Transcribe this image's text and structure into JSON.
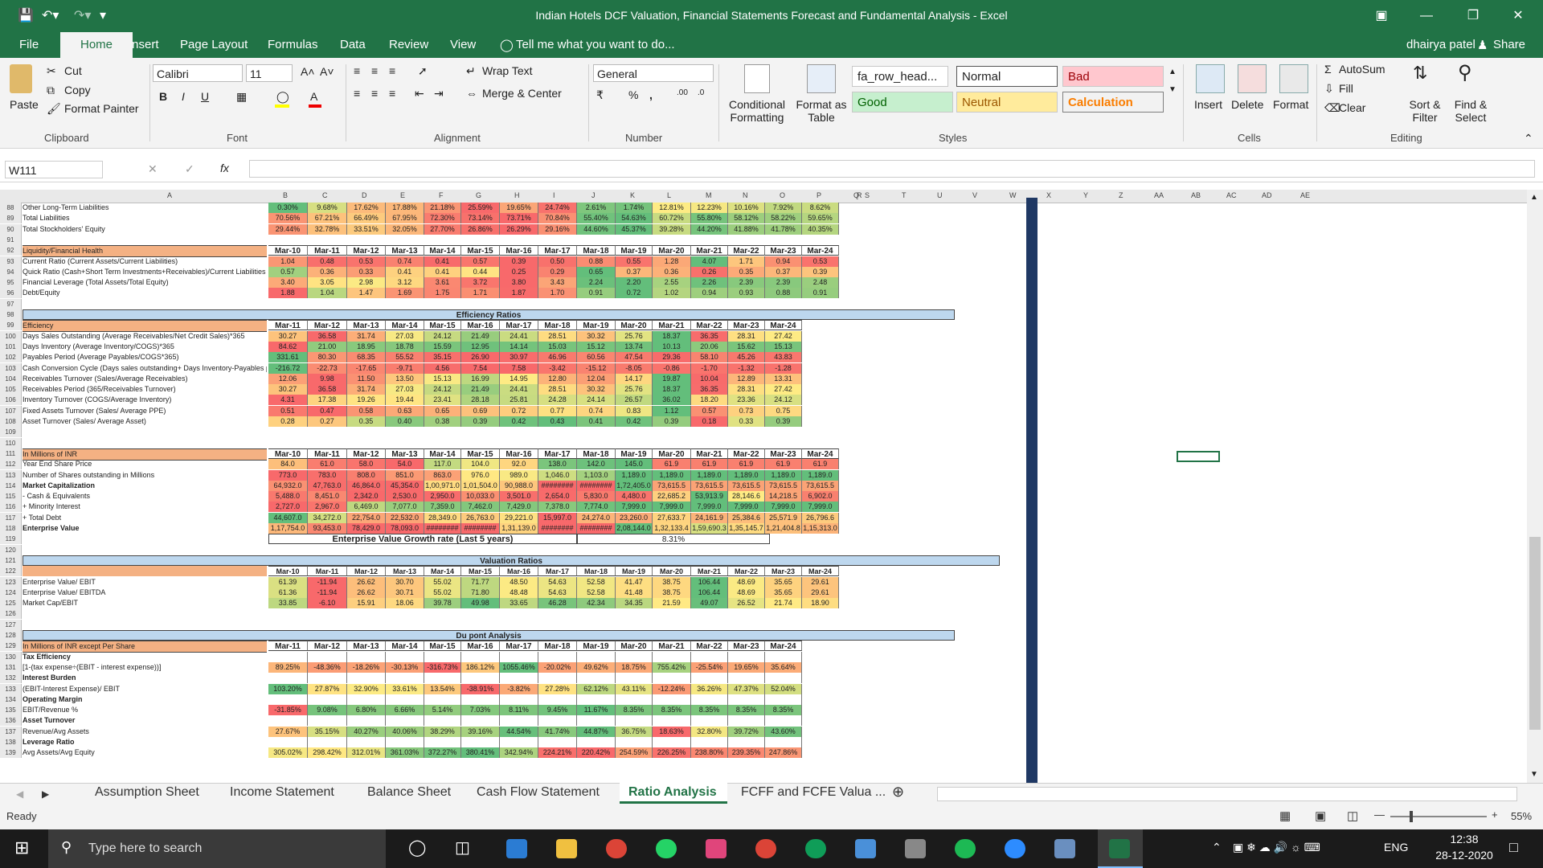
{
  "window": {
    "title": "Indian Hotels DCF Valuation, Financial Statements Forecast and Fundamental Analysis - Excel",
    "user": "dhairya patel",
    "share_label": "Share"
  },
  "ribbon_tabs": [
    "File",
    "Home",
    "Insert",
    "Page Layout",
    "Formulas",
    "Data",
    "Review",
    "View"
  ],
  "tell_me": "Tell me what you want to do...",
  "clipboard": {
    "paste": "Paste",
    "cut": "Cut",
    "copy": "Copy",
    "format_painter": "Format Painter",
    "label": "Clipboard"
  },
  "font": {
    "name": "Calibri",
    "size": "11",
    "label": "Font"
  },
  "alignment": {
    "wrap": "Wrap Text",
    "merge": "Merge & Center",
    "label": "Alignment"
  },
  "number": {
    "format": "General",
    "label": "Number"
  },
  "styles": {
    "conditional": "Conditional Formatting",
    "format_table": "Format as Table",
    "fa_row": "fa_row_head...",
    "normal": "Normal",
    "bad": "Bad",
    "good": "Good",
    "neutral": "Neutral",
    "calculation": "Calculation",
    "label": "Styles"
  },
  "cells": {
    "insert": "Insert",
    "delete": "Delete",
    "format": "Format",
    "label": "Cells"
  },
  "editing": {
    "autosum": "AutoSum",
    "fill": "Fill",
    "clear": "Clear",
    "sort": "Sort & Filter",
    "find": "Find & Select",
    "label": "Editing"
  },
  "formula_bar": {
    "name_box": "W111",
    "fx": "fx",
    "value": ""
  },
  "columns": [
    "A",
    "B",
    "C",
    "D",
    "E",
    "F",
    "G",
    "H",
    "I",
    "J",
    "K",
    "L",
    "M",
    "N",
    "O",
    "P",
    "Q",
    "R",
    "S",
    "T",
    "U",
    "V",
    "W",
    "X",
    "Y",
    "Z",
    "AA",
    "AB",
    "AC",
    "AD",
    "AE"
  ],
  "sections": {
    "top": {
      "rows": [
        {
          "n": "88",
          "label": "Other Long-Term Liabilities",
          "vals": [
            "0.30%",
            "9.68%",
            "17.62%",
            "17.88%",
            "21.18%",
            "25.59%",
            "19.65%",
            "24.74%",
            "2.61%",
            "1.74%",
            "12.81%",
            "12.23%",
            "10.16%",
            "7.92%",
            "8.62%"
          ]
        },
        {
          "n": "89",
          "label": "Total Liabilities",
          "vals": [
            "70.56%",
            "67.21%",
            "66.49%",
            "67.95%",
            "72.30%",
            "73.14%",
            "73.71%",
            "70.84%",
            "55.40%",
            "54.63%",
            "60.72%",
            "55.80%",
            "58.12%",
            "58.22%",
            "59.65%"
          ]
        },
        {
          "n": "90",
          "label": "Total Stockholders' Equity",
          "vals": [
            "29.44%",
            "32.78%",
            "33.51%",
            "32.05%",
            "27.70%",
            "26.86%",
            "26.29%",
            "29.16%",
            "44.60%",
            "45.37%",
            "39.28%",
            "44.20%",
            "41.88%",
            "41.78%",
            "40.35%"
          ]
        }
      ]
    },
    "liquidity": {
      "header_label": "Liquidity/Financial Health",
      "years": [
        "Mar-10",
        "Mar-11",
        "Mar-12",
        "Mar-13",
        "Mar-14",
        "Mar-15",
        "Mar-16",
        "Mar-17",
        "Mar-18",
        "Mar-19",
        "Mar-20",
        "Mar-21",
        "Mar-22",
        "Mar-23",
        "Mar-24"
      ],
      "rows": [
        {
          "n": "93",
          "label": "Current Ratio (Current Assets/Current Liabilities)",
          "vals": [
            "1.04",
            "0.48",
            "0.53",
            "0.74",
            "0.41",
            "0.57",
            "0.39",
            "0.50",
            "0.88",
            "0.55",
            "1.28",
            "4.07",
            "1.71",
            "0.94",
            "0.53"
          ]
        },
        {
          "n": "94",
          "label": "Quick Ratio (Cash+Short Term Investments+Receivables)/Current Liabilities",
          "vals": [
            "0.57",
            "0.36",
            "0.33",
            "0.41",
            "0.41",
            "0.44",
            "0.25",
            "0.29",
            "0.65",
            "0.37",
            "0.36",
            "0.26",
            "0.35",
            "0.37",
            "0.39"
          ]
        },
        {
          "n": "95",
          "label": "Financial Leverage (Total Assets/Total Equity)",
          "vals": [
            "3.40",
            "3.05",
            "2.98",
            "3.12",
            "3.61",
            "3.72",
            "3.80",
            "3.43",
            "2.24",
            "2.20",
            "2.55",
            "2.26",
            "2.39",
            "2.39",
            "2.48"
          ]
        },
        {
          "n": "96",
          "label": "Debt/Equity",
          "vals": [
            "1.88",
            "1.04",
            "1.47",
            "1.69",
            "1.75",
            "1.71",
            "1.87",
            "1.70",
            "0.91",
            "0.72",
            "1.02",
            "0.94",
            "0.93",
            "0.88",
            "0.91"
          ]
        }
      ]
    },
    "efficiency": {
      "title": "Efficiency Ratios",
      "header_label": "Efficiency",
      "years": [
        "Mar-11",
        "Mar-12",
        "Mar-13",
        "Mar-14",
        "Mar-15",
        "Mar-16",
        "Mar-17",
        "Mar-18",
        "Mar-19",
        "Mar-20",
        "Mar-21",
        "Mar-22",
        "Mar-23",
        "Mar-24"
      ],
      "rows": [
        {
          "n": "100",
          "label": "Days Sales Outstanding (Average Receivables/Net Credit Sales)*365",
          "vals": [
            "30.27",
            "36.58",
            "31.74",
            "27.03",
            "24.12",
            "21.49",
            "24.41",
            "28.51",
            "30.32",
            "25.76",
            "18.37",
            "36.35",
            "28.31",
            "27.42"
          ]
        },
        {
          "n": "101",
          "label": "Days Inventory (Average Inventory/COGS)*365",
          "vals": [
            "84.62",
            "21.00",
            "18.95",
            "18.78",
            "15.59",
            "12.95",
            "14.14",
            "15.03",
            "15.12",
            "13.74",
            "10.13",
            "20.06",
            "15.62",
            "15.13"
          ]
        },
        {
          "n": "102",
          "label": "Payables Period (Average Payables/COGS*365)",
          "vals": [
            "331.61",
            "80.30",
            "68.35",
            "55.52",
            "35.15",
            "26.90",
            "30.97",
            "46.96",
            "60.56",
            "47.54",
            "29.36",
            "58.10",
            "45.26",
            "43.83"
          ]
        },
        {
          "n": "103",
          "label": "Cash Conversion Cycle (Days sales outstanding+ Days Inventory-Payables period)",
          "vals": [
            "-216.72",
            "-22.73",
            "-17.65",
            "-9.71",
            "4.56",
            "7.54",
            "7.58",
            "-3.42",
            "-15.12",
            "-8.05",
            "-0.86",
            "-1.70",
            "-1.32",
            "-1.28"
          ]
        },
        {
          "n": "104",
          "label": "Receivables Turnover (Sales/Average Receivables)",
          "vals": [
            "12.06",
            "9.98",
            "11.50",
            "13.50",
            "15.13",
            "16.99",
            "14.95",
            "12.80",
            "12.04",
            "14.17",
            "19.87",
            "10.04",
            "12.89",
            "13.31"
          ]
        },
        {
          "n": "105",
          "label": "Receivables Period (365/Receivables Turnover)",
          "vals": [
            "30.27",
            "36.58",
            "31.74",
            "27.03",
            "24.12",
            "21.49",
            "24.41",
            "28.51",
            "30.32",
            "25.76",
            "18.37",
            "36.35",
            "28.31",
            "27.42"
          ]
        },
        {
          "n": "106",
          "label": "Inventory Turnover (COGS/Average Inventory)",
          "vals": [
            "4.31",
            "17.38",
            "19.26",
            "19.44",
            "23.41",
            "28.18",
            "25.81",
            "24.28",
            "24.14",
            "26.57",
            "36.02",
            "18.20",
            "23.36",
            "24.12"
          ]
        },
        {
          "n": "107",
          "label": "Fixed Assets Turnover (Sales/ Average PPE)",
          "vals": [
            "0.51",
            "0.47",
            "0.58",
            "0.63",
            "0.65",
            "0.69",
            "0.72",
            "0.77",
            "0.74",
            "0.83",
            "1.12",
            "0.57",
            "0.73",
            "0.75"
          ]
        },
        {
          "n": "108",
          "label": "Asset Turnover (Sales/ Average Asset)",
          "vals": [
            "0.28",
            "0.27",
            "0.35",
            "0.40",
            "0.38",
            "0.39",
            "0.42",
            "0.43",
            "0.41",
            "0.42",
            "0.39",
            "0.18",
            "0.33",
            "0.39"
          ]
        }
      ]
    },
    "ev": {
      "header_label": "In Millions of INR",
      "years": [
        "Mar-10",
        "Mar-11",
        "Mar-12",
        "Mar-13",
        "Mar-14",
        "Mar-15",
        "Mar-16",
        "Mar-17",
        "Mar-18",
        "Mar-19",
        "Mar-20",
        "Mar-21",
        "Mar-22",
        "Mar-23",
        "Mar-24"
      ],
      "rows": [
        {
          "n": "112",
          "label": "Year End Share Price",
          "bold": false,
          "vals": [
            "84.0",
            "61.0",
            "58.0",
            "54.0",
            "117.0",
            "104.0",
            "92.0",
            "138.0",
            "142.0",
            "145.0",
            "61.9",
            "61.9",
            "61.9",
            "61.9",
            "61.9"
          ]
        },
        {
          "n": "113",
          "label": "Number of Shares outstanding in Millions",
          "bold": false,
          "vals": [
            "773.0",
            "783.0",
            "808.0",
            "851.0",
            "863.0",
            "976.0",
            "989.0",
            "1,046.0",
            "1,103.0",
            "1,189.0",
            "1,189.0",
            "1,189.0",
            "1,189.0",
            "1,189.0",
            "1,189.0"
          ]
        },
        {
          "n": "114",
          "label": "Market Capitalization",
          "bold": true,
          "vals": [
            "64,932.0",
            "47,763.0",
            "46,864.0",
            "45,354.0",
            "1,00,971.0",
            "1,01,504.0",
            "90,988.0",
            "########",
            "########",
            "1,72,405.0",
            "73,615.5",
            "73,615.5",
            "73,615.5",
            "73,615.5",
            "73,615.5"
          ]
        },
        {
          "n": "115",
          "label": "- Cash & Equivalents",
          "bold": false,
          "vals": [
            "5,488.0",
            "8,451.0",
            "2,342.0",
            "2,530.0",
            "2,950.0",
            "10,033.0",
            "3,501.0",
            "2,654.0",
            "5,830.0",
            "4,480.0",
            "22,685.2",
            "53,913.9",
            "28,146.6",
            "14,218.5",
            "6,902.0"
          ]
        },
        {
          "n": "116",
          "label": "+ Minority Interest",
          "bold": false,
          "vals": [
            "2,727.0",
            "2,967.0",
            "6,469.0",
            "7,077.0",
            "7,359.0",
            "7,462.0",
            "7,429.0",
            "7,378.0",
            "7,774.0",
            "7,999.0",
            "7,999.0",
            "7,999.0",
            "7,999.0",
            "7,999.0",
            "7,999.0"
          ]
        },
        {
          "n": "117",
          "label": "+ Total Debt",
          "bold": false,
          "vals": [
            "44,607.0",
            "34,272.0",
            "22,754.0",
            "22,532.0",
            "28,349.0",
            "26,763.0",
            "29,221.0",
            "15,997.0",
            "24,274.0",
            "23,260.0",
            "27,633.7",
            "24,161.9",
            "25,384.6",
            "25,571.9",
            "26,796.6"
          ]
        },
        {
          "n": "118",
          "label": "Enterprise Value",
          "bold": true,
          "vals": [
            "1,17,754.0",
            "93,453.0",
            "78,429.0",
            "78,093.0",
            "########",
            "########",
            "1,31,139.0",
            "########",
            "########",
            "2,08,144.0",
            "1,32,133.4",
            "1,59,690.3",
            "1,35,145.7",
            "1,21,404.8",
            "1,15,313.0"
          ]
        }
      ],
      "growth_label": "Enterprise Value Growth rate (Last 5 years)",
      "growth_value": "8.31%"
    },
    "valuation": {
      "title": "Valuation Ratios",
      "years": [
        "Mar-10",
        "Mar-11",
        "Mar-12",
        "Mar-13",
        "Mar-14",
        "Mar-15",
        "Mar-16",
        "Mar-17",
        "Mar-18",
        "Mar-19",
        "Mar-20",
        "Mar-21",
        "Mar-22",
        "Mar-23",
        "Mar-24"
      ],
      "rows": [
        {
          "n": "123",
          "label": "Enterprise Value/ EBIT",
          "vals": [
            "61.39",
            "-11.94",
            "26.62",
            "30.70",
            "55.02",
            "71.77",
            "48.50",
            "54.63",
            "52.58",
            "41.47",
            "38.75",
            "106.44",
            "48.69",
            "35.65",
            "29.61"
          ]
        },
        {
          "n": "124",
          "label": "Enterprise Value/ EBITDA",
          "vals": [
            "61.36",
            "-11.94",
            "26.62",
            "30.71",
            "55.02",
            "71.80",
            "48.48",
            "54.63",
            "52.58",
            "41.48",
            "38.75",
            "106.44",
            "48.69",
            "35.65",
            "29.61"
          ]
        },
        {
          "n": "125",
          "label": "Market Cap/EBIT",
          "vals": [
            "33.85",
            "-6.10",
            "15.91",
            "18.06",
            "39.78",
            "49.98",
            "33.65",
            "46.28",
            "42.34",
            "34.35",
            "21.59",
            "49.07",
            "26.52",
            "21.74",
            "18.90"
          ]
        }
      ]
    },
    "dupont": {
      "title": "Du pont Analysis",
      "header_label": "In Millions of INR except Per Share",
      "years": [
        "Mar-11",
        "Mar-12",
        "Mar-13",
        "Mar-14",
        "Mar-15",
        "Mar-16",
        "Mar-17",
        "Mar-18",
        "Mar-19",
        "Mar-20",
        "Mar-21",
        "Mar-22",
        "Mar-23",
        "Mar-24"
      ],
      "rows": [
        {
          "n": "130",
          "label": "Tax Efficiency",
          "bold": true,
          "vals": []
        },
        {
          "n": "131",
          "label": "[1-(tax expense÷(EBIT - interest expense))]",
          "bold": false,
          "vals": [
            "89.25%",
            "-48.36%",
            "-18.26%",
            "-30.13%",
            "-316.73%",
            "186.12%",
            "1055.46%",
            "-20.02%",
            "49.62%",
            "18.75%",
            "755.42%",
            "-25.54%",
            "19.65%",
            "35.64%"
          ]
        },
        {
          "n": "132",
          "label": "Interest Burden",
          "bold": true,
          "vals": []
        },
        {
          "n": "133",
          "label": "(EBIT-Interest Expense)/ EBIT",
          "bold": false,
          "vals": [
            "103.20%",
            "27.87%",
            "32.90%",
            "33.61%",
            "13.54%",
            "-38.91%",
            "-3.82%",
            "27.28%",
            "62.12%",
            "43.11%",
            "-12.24%",
            "36.26%",
            "47.37%",
            "52.04%"
          ]
        },
        {
          "n": "134",
          "label": "Operating Margin",
          "bold": true,
          "vals": []
        },
        {
          "n": "135",
          "label": "EBIT/Revenue %",
          "bold": false,
          "vals": [
            "-31.85%",
            "9.08%",
            "6.80%",
            "6.66%",
            "5.14%",
            "7.03%",
            "8.11%",
            "9.45%",
            "11.67%",
            "8.35%",
            "8.35%",
            "8.35%",
            "8.35%",
            "8.35%"
          ]
        },
        {
          "n": "136",
          "label": "Asset Turnover",
          "bold": true,
          "vals": []
        },
        {
          "n": "137",
          "label": "Revenue/Avg Assets",
          "bold": false,
          "vals": [
            "27.67%",
            "35.15%",
            "40.27%",
            "40.06%",
            "38.29%",
            "39.16%",
            "44.54%",
            "41.74%",
            "44.87%",
            "36.75%",
            "18.63%",
            "32.80%",
            "39.72%",
            "43.60%"
          ]
        },
        {
          "n": "138",
          "label": "Leverage Ratio",
          "bold": true,
          "vals": []
        },
        {
          "n": "139",
          "label": "Avg Assets/Avg Equity",
          "bold": false,
          "vals": [
            "305.02%",
            "298.42%",
            "312.01%",
            "361.03%",
            "372.27%",
            "380.41%",
            "342.94%",
            "224.21%",
            "220.42%",
            "254.59%",
            "226.25%",
            "238.80%",
            "239.35%",
            "247.86%"
          ]
        }
      ]
    }
  },
  "blank_rows": [
    "91",
    "97",
    "98",
    "109",
    "110",
    "120",
    "121",
    "126",
    "127",
    "128"
  ],
  "sheet_tabs": [
    "Assumption Sheet",
    "Income Statement",
    "Balance Sheet",
    "Cash Flow Statement",
    "Ratio Analysis",
    "FCFF and FCFE Valua ..."
  ],
  "active_sheet": "Ratio Analysis",
  "status": {
    "ready": "Ready",
    "zoom": "55%"
  },
  "taskbar": {
    "search_placeholder": "Type here to search",
    "lang": "ENG",
    "time": "12:38",
    "date": "28-12-2020"
  },
  "colors": {
    "excel_green": "#217346",
    "header_orange": "#f4b183",
    "banner_blue": "#bdd7ee",
    "good": "#c6efce",
    "bad": "#ffc7ce",
    "neutral": "#ffeb9c"
  }
}
